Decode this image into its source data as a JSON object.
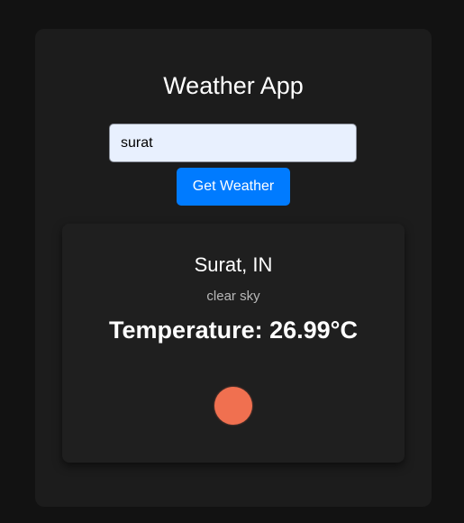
{
  "app": {
    "title": "Weather App"
  },
  "search": {
    "value": "surat"
  },
  "actions": {
    "get_weather_label": "Get Weather"
  },
  "result": {
    "city": "Surat, IN",
    "description": "clear sky",
    "temperature": "Temperature: 26.99°C",
    "icon": "sun-icon"
  },
  "colors": {
    "background": "#121212",
    "card": "#1c1c1c",
    "button": "#007bff",
    "icon": "#f07050"
  }
}
